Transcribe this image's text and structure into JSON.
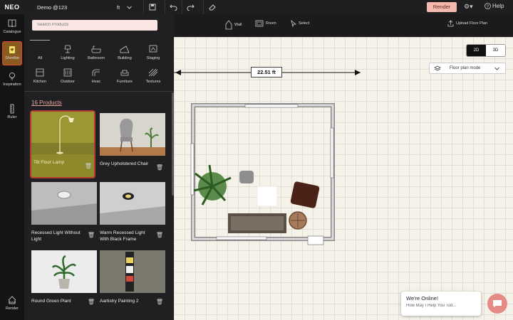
{
  "topbar": {
    "logo": "NEO",
    "project_name": "Demo @123",
    "unit": "ft",
    "render_label": "Render",
    "help_label": "Help"
  },
  "toolbar": {
    "wall": "Wall",
    "room": "Room",
    "select": "Select",
    "upload": "Upload Floor Plan"
  },
  "leftnav": {
    "catalogue": "Catalogue",
    "shortlist": "Shortlist",
    "inspiration": "Inspiration",
    "ruler": "Ruler",
    "render": "Render"
  },
  "panel": {
    "search_placeholder": "Search Products",
    "categories": [
      "All",
      "Lighting",
      "Bathroom",
      "Building",
      "Staging",
      "Kitchen",
      "Outdoor",
      "Hvac",
      "Furniture",
      "Textures"
    ],
    "count": "16 Products",
    "products": [
      "Tilt Floor Lamp",
      "Grey Upholstered Chair",
      "Recessed Light Without Light",
      "Warm Recessed Light With Black Frame",
      "Round Green Plant",
      "Aartistry Painting 2"
    ]
  },
  "canvas": {
    "view_2d": "2D",
    "view_3d": "3D",
    "mode": "Floor plan mode",
    "dimension": "22.51 ft"
  },
  "chat": {
    "title": "We're Online!",
    "subtitle": "How May I Help You Tod..."
  },
  "colors": {
    "accent": "#f4b9ad",
    "selected_border": "#b13a32",
    "panel_bg": "#202022"
  }
}
